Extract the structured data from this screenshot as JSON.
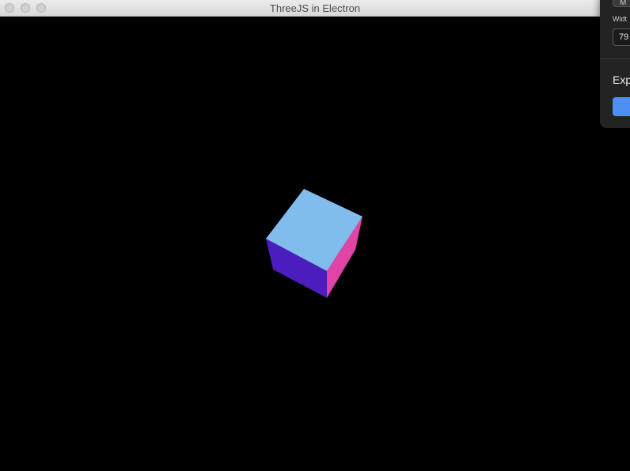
{
  "window": {
    "title": "ThreeJS in Electron"
  },
  "scene": {
    "background": "#000000",
    "cube_colors": {
      "top": "#80bcec",
      "left": "#4c1dbe",
      "right": "#e243a6"
    }
  },
  "panel": {
    "select_value": "M",
    "width_label": "Widt",
    "width_value": "79",
    "heading": "Exp",
    "button_color": "#4f8ef5"
  }
}
